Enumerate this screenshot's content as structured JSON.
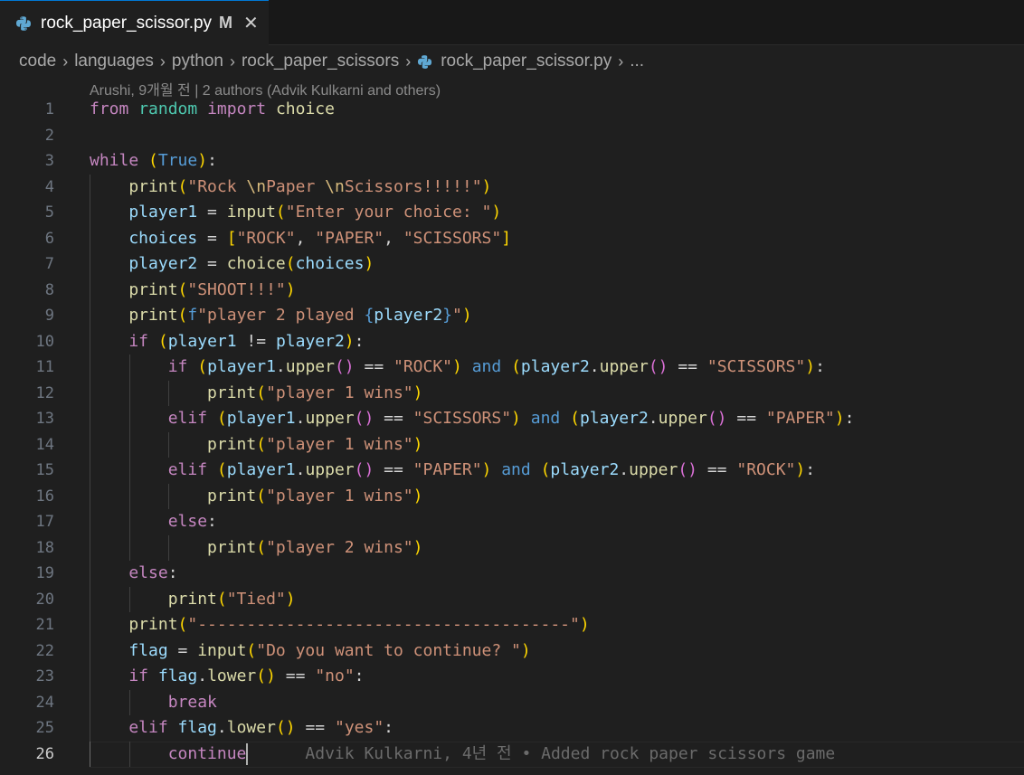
{
  "tab": {
    "filename": "rock_paper_scissor.py",
    "modified": "M",
    "close_icon": "close-icon",
    "file_icon": "python-icon"
  },
  "breadcrumb": {
    "items": [
      "code",
      "languages",
      "python",
      "rock_paper_scissors",
      "rock_paper_scissor.py",
      "..."
    ]
  },
  "blame_header": "Arushi, 9개월 전 | 2 authors (Advik Kulkarni and others)",
  "inline_blame": "Advik Kulkarni, 4년 전 • Added rock paper scissors game",
  "current_line": 26,
  "colors": {
    "accent": "#0078d4",
    "keyword": "#c586c0",
    "string": "#ce9178",
    "function": "#dcdcaa",
    "variable": "#9cdcfe"
  },
  "code_lines": [
    {
      "n": "1",
      "indent": 0,
      "tokens": [
        [
          "from",
          "kw"
        ],
        [
          " ",
          ""
        ],
        [
          "random",
          "mod"
        ],
        [
          " ",
          ""
        ],
        [
          "import",
          "kw"
        ],
        [
          " ",
          ""
        ],
        [
          "choice",
          "fn"
        ]
      ]
    },
    {
      "n": "2",
      "indent": 0,
      "tokens": []
    },
    {
      "n": "3",
      "indent": 0,
      "tokens": [
        [
          "while",
          "kw"
        ],
        [
          " ",
          ""
        ],
        [
          "(",
          "p1"
        ],
        [
          "True",
          "kb"
        ],
        [
          ")",
          "p1"
        ],
        [
          ":",
          "op"
        ]
      ]
    },
    {
      "n": "4",
      "indent": 1,
      "tokens": [
        [
          "print",
          "fn"
        ],
        [
          "(",
          "p1"
        ],
        [
          "\"Rock ",
          "str"
        ],
        [
          "\\n",
          "esc"
        ],
        [
          "Paper ",
          "str"
        ],
        [
          "\\n",
          "esc"
        ],
        [
          "Scissors!!!!!\"",
          "str"
        ],
        [
          ")",
          "p1"
        ]
      ]
    },
    {
      "n": "5",
      "indent": 1,
      "tokens": [
        [
          "player1",
          "var"
        ],
        [
          " = ",
          "op"
        ],
        [
          "input",
          "fn"
        ],
        [
          "(",
          "p1"
        ],
        [
          "\"Enter your choice: \"",
          "str"
        ],
        [
          ")",
          "p1"
        ]
      ]
    },
    {
      "n": "6",
      "indent": 1,
      "tokens": [
        [
          "choices",
          "var"
        ],
        [
          " = ",
          "op"
        ],
        [
          "[",
          "p1"
        ],
        [
          "\"ROCK\"",
          "str"
        ],
        [
          ", ",
          "op"
        ],
        [
          "\"PAPER\"",
          "str"
        ],
        [
          ", ",
          "op"
        ],
        [
          "\"SCISSORS\"",
          "str"
        ],
        [
          "]",
          "p1"
        ]
      ]
    },
    {
      "n": "7",
      "indent": 1,
      "tokens": [
        [
          "player2",
          "var"
        ],
        [
          " = ",
          "op"
        ],
        [
          "choice",
          "fn"
        ],
        [
          "(",
          "p1"
        ],
        [
          "choices",
          "var"
        ],
        [
          ")",
          "p1"
        ]
      ]
    },
    {
      "n": "8",
      "indent": 1,
      "tokens": [
        [
          "print",
          "fn"
        ],
        [
          "(",
          "p1"
        ],
        [
          "\"SHOOT!!!\"",
          "str"
        ],
        [
          ")",
          "p1"
        ]
      ]
    },
    {
      "n": "9",
      "indent": 1,
      "tokens": [
        [
          "print",
          "fn"
        ],
        [
          "(",
          "p1"
        ],
        [
          "f",
          "kb"
        ],
        [
          "\"player 2 played ",
          "str"
        ],
        [
          "{",
          "kb"
        ],
        [
          "player2",
          "var"
        ],
        [
          "}",
          "kb"
        ],
        [
          "\"",
          "str"
        ],
        [
          ")",
          "p1"
        ]
      ]
    },
    {
      "n": "10",
      "indent": 1,
      "tokens": [
        [
          "if",
          "kw"
        ],
        [
          " ",
          ""
        ],
        [
          "(",
          "p1"
        ],
        [
          "player1",
          "var"
        ],
        [
          " != ",
          "op"
        ],
        [
          "player2",
          "var"
        ],
        [
          ")",
          "p1"
        ],
        [
          ":",
          "op"
        ]
      ]
    },
    {
      "n": "11",
      "indent": 2,
      "tokens": [
        [
          "if",
          "kw"
        ],
        [
          " ",
          ""
        ],
        [
          "(",
          "p1"
        ],
        [
          "player1",
          "var"
        ],
        [
          ".",
          "op"
        ],
        [
          "upper",
          "fn"
        ],
        [
          "()",
          "p2"
        ],
        [
          " == ",
          "op"
        ],
        [
          "\"ROCK\"",
          "str"
        ],
        [
          ")",
          "p1"
        ],
        [
          " ",
          ""
        ],
        [
          "and",
          "kb"
        ],
        [
          " ",
          ""
        ],
        [
          "(",
          "p1"
        ],
        [
          "player2",
          "var"
        ],
        [
          ".",
          "op"
        ],
        [
          "upper",
          "fn"
        ],
        [
          "()",
          "p2"
        ],
        [
          " == ",
          "op"
        ],
        [
          "\"SCISSORS\"",
          "str"
        ],
        [
          ")",
          "p1"
        ],
        [
          ":",
          "op"
        ]
      ]
    },
    {
      "n": "12",
      "indent": 3,
      "tokens": [
        [
          "print",
          "fn"
        ],
        [
          "(",
          "p1"
        ],
        [
          "\"player 1 wins\"",
          "str"
        ],
        [
          ")",
          "p1"
        ]
      ]
    },
    {
      "n": "13",
      "indent": 2,
      "tokens": [
        [
          "elif",
          "kw"
        ],
        [
          " ",
          ""
        ],
        [
          "(",
          "p1"
        ],
        [
          "player1",
          "var"
        ],
        [
          ".",
          "op"
        ],
        [
          "upper",
          "fn"
        ],
        [
          "()",
          "p2"
        ],
        [
          " == ",
          "op"
        ],
        [
          "\"SCISSORS\"",
          "str"
        ],
        [
          ")",
          "p1"
        ],
        [
          " ",
          ""
        ],
        [
          "and",
          "kb"
        ],
        [
          " ",
          ""
        ],
        [
          "(",
          "p1"
        ],
        [
          "player2",
          "var"
        ],
        [
          ".",
          "op"
        ],
        [
          "upper",
          "fn"
        ],
        [
          "()",
          "p2"
        ],
        [
          " == ",
          "op"
        ],
        [
          "\"PAPER\"",
          "str"
        ],
        [
          ")",
          "p1"
        ],
        [
          ":",
          "op"
        ]
      ]
    },
    {
      "n": "14",
      "indent": 3,
      "tokens": [
        [
          "print",
          "fn"
        ],
        [
          "(",
          "p1"
        ],
        [
          "\"player 1 wins\"",
          "str"
        ],
        [
          ")",
          "p1"
        ]
      ]
    },
    {
      "n": "15",
      "indent": 2,
      "tokens": [
        [
          "elif",
          "kw"
        ],
        [
          " ",
          ""
        ],
        [
          "(",
          "p1"
        ],
        [
          "player1",
          "var"
        ],
        [
          ".",
          "op"
        ],
        [
          "upper",
          "fn"
        ],
        [
          "()",
          "p2"
        ],
        [
          " == ",
          "op"
        ],
        [
          "\"PAPER\"",
          "str"
        ],
        [
          ")",
          "p1"
        ],
        [
          " ",
          ""
        ],
        [
          "and",
          "kb"
        ],
        [
          " ",
          ""
        ],
        [
          "(",
          "p1"
        ],
        [
          "player2",
          "var"
        ],
        [
          ".",
          "op"
        ],
        [
          "upper",
          "fn"
        ],
        [
          "()",
          "p2"
        ],
        [
          " == ",
          "op"
        ],
        [
          "\"ROCK\"",
          "str"
        ],
        [
          ")",
          "p1"
        ],
        [
          ":",
          "op"
        ]
      ]
    },
    {
      "n": "16",
      "indent": 3,
      "tokens": [
        [
          "print",
          "fn"
        ],
        [
          "(",
          "p1"
        ],
        [
          "\"player 1 wins\"",
          "str"
        ],
        [
          ")",
          "p1"
        ]
      ]
    },
    {
      "n": "17",
      "indent": 2,
      "tokens": [
        [
          "else",
          "kw"
        ],
        [
          ":",
          "op"
        ]
      ]
    },
    {
      "n": "18",
      "indent": 3,
      "tokens": [
        [
          "print",
          "fn"
        ],
        [
          "(",
          "p1"
        ],
        [
          "\"player 2 wins\"",
          "str"
        ],
        [
          ")",
          "p1"
        ]
      ]
    },
    {
      "n": "19",
      "indent": 1,
      "tokens": [
        [
          "else",
          "kw"
        ],
        [
          ":",
          "op"
        ]
      ]
    },
    {
      "n": "20",
      "indent": 2,
      "tokens": [
        [
          "print",
          "fn"
        ],
        [
          "(",
          "p1"
        ],
        [
          "\"Tied\"",
          "str"
        ],
        [
          ")",
          "p1"
        ]
      ]
    },
    {
      "n": "21",
      "indent": 1,
      "tokens": [
        [
          "print",
          "fn"
        ],
        [
          "(",
          "p1"
        ],
        [
          "\"--------------------------------------\"",
          "str"
        ],
        [
          ")",
          "p1"
        ]
      ]
    },
    {
      "n": "22",
      "indent": 1,
      "tokens": [
        [
          "flag",
          "var"
        ],
        [
          " = ",
          "op"
        ],
        [
          "input",
          "fn"
        ],
        [
          "(",
          "p1"
        ],
        [
          "\"Do you want to continue? \"",
          "str"
        ],
        [
          ")",
          "p1"
        ]
      ]
    },
    {
      "n": "23",
      "indent": 1,
      "tokens": [
        [
          "if",
          "kw"
        ],
        [
          " ",
          ""
        ],
        [
          "flag",
          "var"
        ],
        [
          ".",
          "op"
        ],
        [
          "lower",
          "fn"
        ],
        [
          "()",
          "p1"
        ],
        [
          " == ",
          "op"
        ],
        [
          "\"no\"",
          "str"
        ],
        [
          ":",
          "op"
        ]
      ]
    },
    {
      "n": "24",
      "indent": 2,
      "tokens": [
        [
          "break",
          "kw"
        ]
      ]
    },
    {
      "n": "25",
      "indent": 1,
      "tokens": [
        [
          "elif",
          "kw"
        ],
        [
          " ",
          ""
        ],
        [
          "flag",
          "var"
        ],
        [
          ".",
          "op"
        ],
        [
          "lower",
          "fn"
        ],
        [
          "()",
          "p1"
        ],
        [
          " == ",
          "op"
        ],
        [
          "\"yes\"",
          "str"
        ],
        [
          ":",
          "op"
        ]
      ]
    },
    {
      "n": "26",
      "indent": 2,
      "tokens": [
        [
          "continue",
          "kw"
        ]
      ]
    }
  ]
}
